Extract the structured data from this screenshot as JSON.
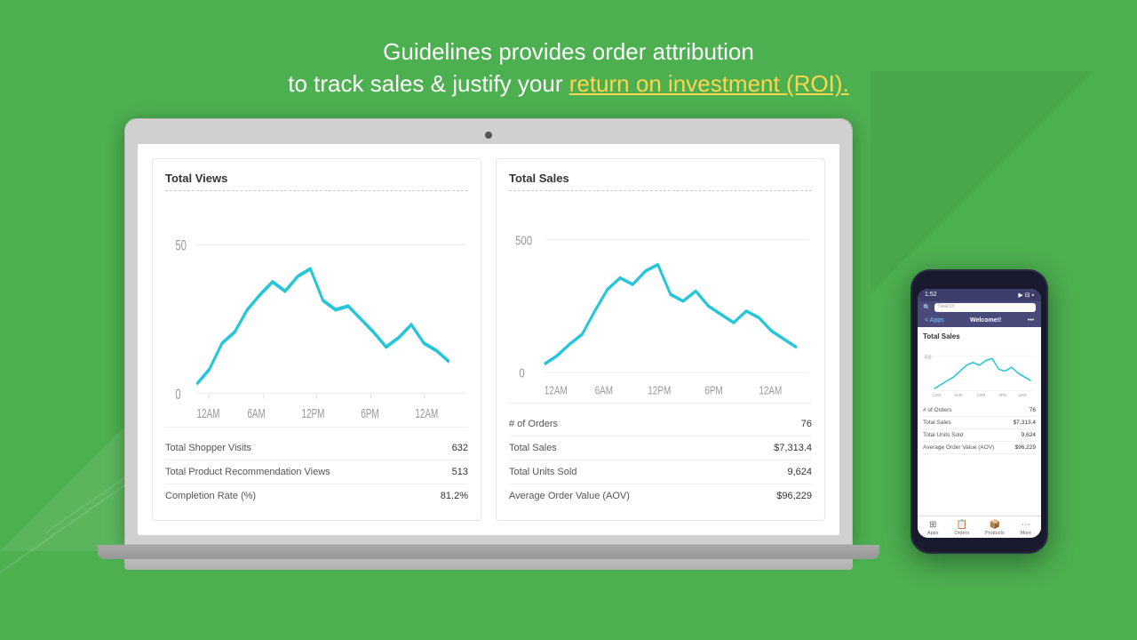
{
  "header": {
    "line1": "Guidelines provides order attribution",
    "line2_prefix": "to track sales & justify your ",
    "line2_highlight": "return on investment (ROI).",
    "highlight_color": "#ffd54f"
  },
  "laptop": {
    "left_panel": {
      "title": "Total Views",
      "chart_label_y": "50",
      "chart_label_y2": "0",
      "chart_x_labels": [
        "12AM",
        "6AM",
        "12PM",
        "6PM",
        "12AM"
      ],
      "stats": [
        {
          "label": "Total Shopper Visits",
          "value": "632"
        },
        {
          "label": "Total Product Recommendation Views",
          "value": "513"
        },
        {
          "label": "Completion Rate (%)",
          "value": "81.2%"
        }
      ]
    },
    "right_panel": {
      "title": "Total Sales",
      "chart_label_y": "500",
      "chart_label_y2": "0",
      "chart_x_labels": [
        "12AM",
        "6AM",
        "12PM",
        "6PM",
        "12AM"
      ],
      "stats": [
        {
          "label": "# of Orders",
          "value": "76"
        },
        {
          "label": "Total Sales",
          "value": "$7,313.4"
        },
        {
          "label": "Total Units Sold",
          "value": "9,624"
        },
        {
          "label": "Average Order Value (AOV)",
          "value": "$96,229"
        }
      ]
    }
  },
  "phone": {
    "time": "1:52",
    "status_icons": "●●●",
    "nav_back": "< Apps",
    "nav_title": "Welcome!!",
    "nav_more": "•••",
    "section_title": "Total Sales",
    "chart_label_y": "500",
    "chart_x_labels": [
      "12AM",
      "6AM",
      "12PM",
      "6PM",
      "12AM"
    ],
    "stats": [
      {
        "label": "# of Orders",
        "value": "76"
      },
      {
        "label": "Total Sales",
        "value": "$7,313.4"
      },
      {
        "label": "Total Units Sold",
        "value": "9,624"
      },
      {
        "label": "Average Order Value (AOV)",
        "value": "$96,229"
      }
    ],
    "tabs": [
      {
        "label": "Apps",
        "icon": "⊞"
      },
      {
        "label": "Orders",
        "icon": "📋"
      },
      {
        "label": "Products",
        "icon": "📦"
      },
      {
        "label": "More",
        "icon": "⋯"
      }
    ]
  },
  "colors": {
    "bg": "#4caf50",
    "highlight": "#ffd54f",
    "teal": "#26c6da",
    "white": "#ffffff"
  }
}
